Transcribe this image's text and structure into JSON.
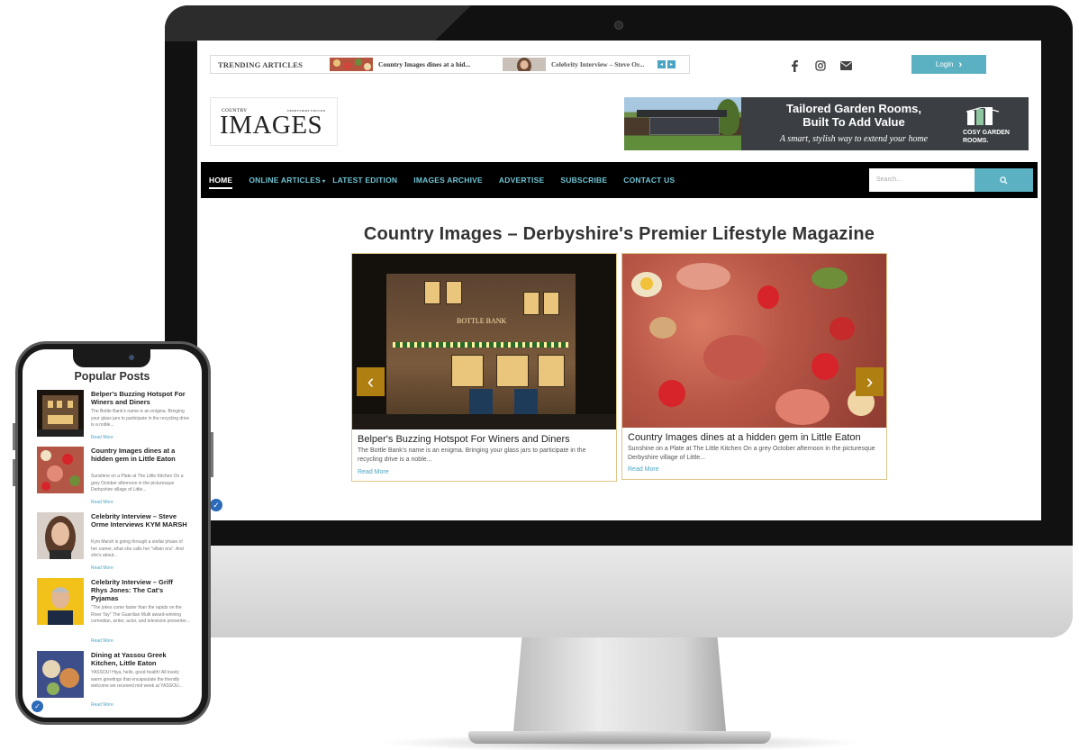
{
  "topbar": {
    "trending_label": "TRENDING ARTICLES",
    "trending_items": [
      {
        "text": "Country Images dines at a hid..."
      },
      {
        "text": "Celebrity Interview – Steve Or..."
      }
    ],
    "social_icons": [
      "facebook-icon",
      "instagram-icon",
      "envelope-icon"
    ],
    "login_label": "Login",
    "login_arrow": "›"
  },
  "logo": {
    "small_text": "COUNTRY",
    "edition_text": "DERBYSHIRE EDITION",
    "big_text": "IMAGES"
  },
  "ad": {
    "title_line1": "Tailored Garden Rooms,",
    "title_line2": "Built To Add Value",
    "subtitle": "A smart, stylish way to extend your home",
    "brand_line1": "COSY GARDEN",
    "brand_line2": "ROOMS."
  },
  "nav": {
    "items": [
      {
        "label": "HOME"
      },
      {
        "label": "ONLINE ARTICLES",
        "caret": "▾"
      },
      {
        "label": "LATEST EDITION"
      },
      {
        "label": "IMAGES ARCHIVE"
      },
      {
        "label": "ADVERTISE"
      },
      {
        "label": "SUBSCRIBE"
      },
      {
        "label": "CONTACT US"
      }
    ],
    "search_placeholder": "Search...",
    "search_icon": "⌕"
  },
  "main": {
    "headline": "Country Images – Derbyshire's Premier Lifestyle Magazine",
    "cards": [
      {
        "title": "Belper's Buzzing Hotspot For Winers and Diners",
        "desc": "The Bottle Bank's name is an enigma. Bringing your glass jars to participate in the recycling drive is a noble...",
        "more": "Read More",
        "sign": "BOTTLE BANK"
      },
      {
        "title": "Country Images dines at a hidden gem in Little Eaton",
        "desc": "Sunshine on a Plate at The Little Kitchen On a grey October afternoon in the picturesque Derbyshire village of Little...",
        "more": "Read More"
      }
    ],
    "arrow_prev": "‹",
    "arrow_next": "›"
  },
  "phone": {
    "title": "Popular Posts",
    "posts": [
      {
        "title": "Belper's Buzzing Hotspot For Winers and Diners",
        "desc": "The Bottle Bank's name is an enigma. Bringing your glass jars to participate in the recycling drive is a noble...",
        "more": "Read More"
      },
      {
        "title": "Country Images dines at a hidden gem in Little Eaton",
        "desc": "Sunshine on a Plate at The Little Kitchen On a grey October afternoon in the picturesque Derbyshire village of Little...",
        "more": "Read More"
      },
      {
        "title": "Celebrity Interview – Steve Orme Interviews KYM MARSH",
        "desc": "Kym Marsh is going through a stellar phase of her career, what she calls her \"villain era\". And she's about...",
        "more": "Read More"
      },
      {
        "title": "Celebrity Interview – Griff Rhys Jones: The Cat's Pyjamas",
        "desc": "\"The jokes come faster than the rapids on the River Tay\" The Guardian Multi award-winning comedian, writer, actor, and television presenter...",
        "more": "Read More"
      },
      {
        "title": "Dining at Yassou Greek Kitchen, Little Eaton",
        "desc": "YASSOU! Hiya, hello, good health! All lovely warm greetings that encapsulate the friendly welcome we received mid week at YASSOU...",
        "more": "Read More"
      }
    ]
  },
  "colors": {
    "accent": "#5bb1c2",
    "nav_bg": "#000000",
    "nav_text": "#6fc3d3",
    "arrow_bg": "#b07f11",
    "card_border": "#e0c58a"
  }
}
